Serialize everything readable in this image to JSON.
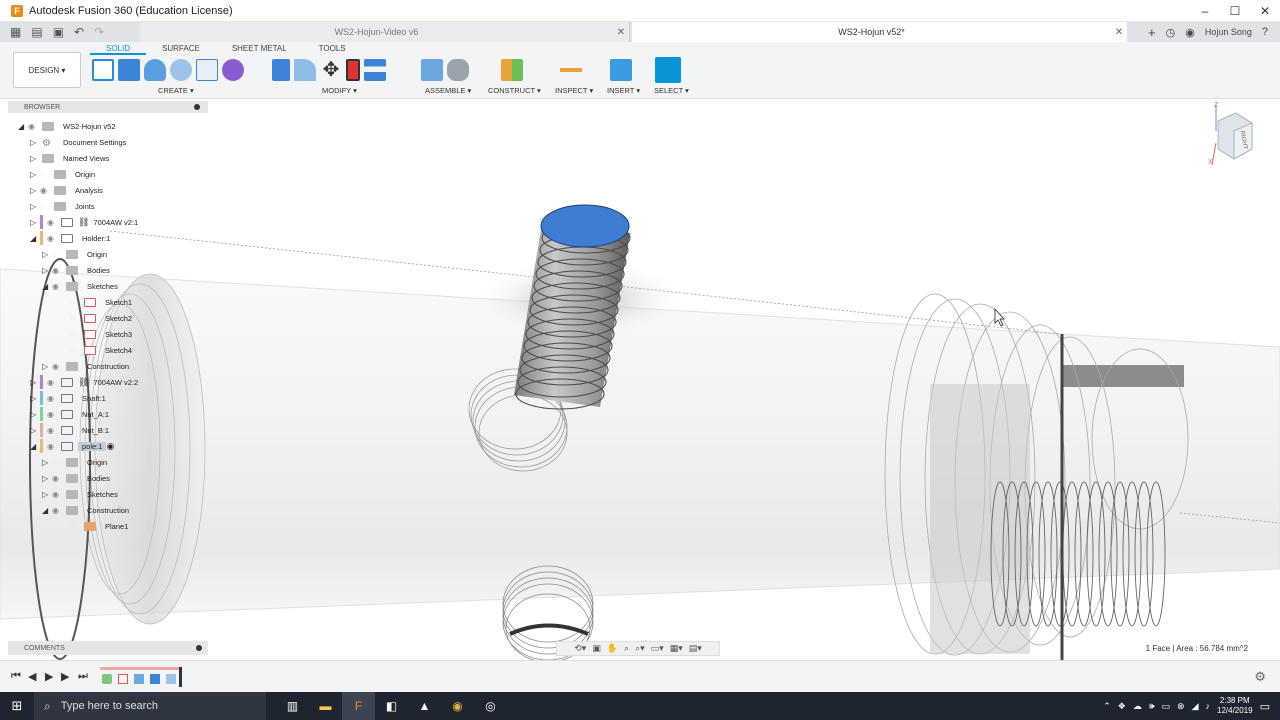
{
  "window": {
    "title": "Autodesk Fusion 360 (Education License)",
    "app_icon": "F",
    "min": "–",
    "max": "☐",
    "close": "✕"
  },
  "tabs": [
    {
      "label": "WS2-Hojun-Video v6",
      "active": false
    },
    {
      "label": "WS2-Hojun v52*",
      "active": true
    }
  ],
  "user": "Hojun Song",
  "toolbar": {
    "workspace": "DESIGN",
    "subtabs": [
      "SOLID",
      "SURFACE",
      "SHEET METAL",
      "TOOLS"
    ],
    "groups": [
      "CREATE",
      "MODIFY",
      "ASSEMBLE",
      "CONSTRUCT",
      "INSPECT",
      "INSERT",
      "SELECT"
    ]
  },
  "browser": {
    "header": "BROWSER",
    "items": [
      {
        "label": "WS2-Hojun v52"
      },
      {
        "label": "Document Settings"
      },
      {
        "label": "Named Views"
      },
      {
        "label": "Origin"
      },
      {
        "label": "Analysis"
      },
      {
        "label": "Joints"
      },
      {
        "label": "7004AW v2:1"
      },
      {
        "label": "Holder:1"
      },
      {
        "label": "Origin"
      },
      {
        "label": "Bodies"
      },
      {
        "label": "Sketches"
      },
      {
        "label": "Sketch1"
      },
      {
        "label": "Sketch2"
      },
      {
        "label": "Sketch3"
      },
      {
        "label": "Sketch4"
      },
      {
        "label": "Construction"
      },
      {
        "label": "7004AW v2:2"
      },
      {
        "label": "Shaft:1"
      },
      {
        "label": "Nut_A:1"
      },
      {
        "label": "Nut_B:1"
      },
      {
        "label": "pole:1"
      },
      {
        "label": "Origin"
      },
      {
        "label": "Bodies"
      },
      {
        "label": "Sketches"
      },
      {
        "label": "Construction"
      },
      {
        "label": "Plane1"
      }
    ]
  },
  "comments": {
    "label": "COMMENTS"
  },
  "status": {
    "text": "1 Face | Area : 56.784 mm^2"
  },
  "viewcube": {
    "face": "RIGHT",
    "axis_z": "Z",
    "axis_x": "X"
  },
  "taskbar": {
    "search_placeholder": "Type here to search",
    "time": "2:38 PM",
    "date": "12/4/2019"
  }
}
